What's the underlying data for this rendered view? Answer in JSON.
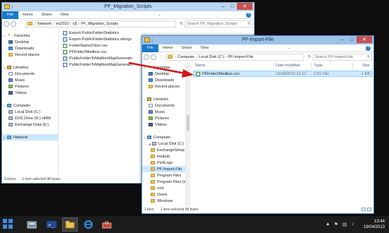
{
  "colors": {
    "accent": "#1979ca",
    "selection": "#cce8ff",
    "arrow": "#d11818"
  },
  "win1": {
    "title": "PF_Migration_Scripts",
    "tabs": [
      "File",
      "Home",
      "Share",
      "View"
    ],
    "address": [
      "Network",
      "ex2010",
      "c$",
      "PF_Migration_Scripts"
    ],
    "search_placeholder": "Search PF_Migration_Scripts",
    "nav": [
      {
        "label": "Favorites",
        "icon": "star-icon",
        "group": true
      },
      {
        "label": "Desktop",
        "icon": "desktop-icon"
      },
      {
        "label": "Downloads",
        "icon": "downloads-icon"
      },
      {
        "label": "Recent places",
        "icon": "recent-places-icon"
      },
      {
        "label": "",
        "icon": ""
      },
      {
        "label": "Libraries",
        "icon": "libraries-icon",
        "group": true
      },
      {
        "label": "Documents",
        "icon": "documents-icon"
      },
      {
        "label": "Music",
        "icon": "music-icon"
      },
      {
        "label": "Pictures",
        "icon": "pictures-icon"
      },
      {
        "label": "Videos",
        "icon": "videos-icon"
      },
      {
        "label": "",
        "icon": ""
      },
      {
        "label": "Computer",
        "icon": "computer-icon",
        "group": true
      },
      {
        "label": "Local Disk (C:)",
        "icon": "drive-icon"
      },
      {
        "label": "DVD Drive (D:) HRM",
        "icon": "dvd-icon"
      },
      {
        "label": "Exchange Data (E:)",
        "icon": "drive-icon"
      },
      {
        "label": "",
        "icon": ""
      },
      {
        "label": "Network",
        "icon": "network-icon",
        "group": true,
        "selected": true
      }
    ],
    "files": [
      {
        "name": "Export-PublicFolderStatistics",
        "type": "ps"
      },
      {
        "name": "Export-PublicFolderStatistics.strings",
        "type": "ps"
      },
      {
        "name": "FolderName2Size.csv",
        "type": "csv"
      },
      {
        "name": "PFfolder2Mailbox.csv",
        "type": "csv"
      },
      {
        "name": "PublicFolderToMailboxMapGenerator",
        "type": "ps"
      },
      {
        "name": "PublicFolderToMailboxMapGenerator.stri...",
        "type": "ps"
      }
    ],
    "status": [
      "6 items",
      "1 item selected  98 bytes"
    ]
  },
  "win2": {
    "title": "PF-Import-File",
    "tabs": [
      "File",
      "Home",
      "Share",
      "View"
    ],
    "address": [
      "Computer",
      "Local Disk (C:)",
      "PF-Import-File"
    ],
    "search_placeholder": "Search PF-Import-File",
    "nav": [
      {
        "label": "Favorites",
        "icon": "star-icon",
        "group": true
      },
      {
        "label": "Desktop",
        "icon": "desktop-icon"
      },
      {
        "label": "Downloads",
        "icon": "downloads-icon"
      },
      {
        "label": "Recent places",
        "icon": "recent-places-icon"
      },
      {
        "label": "",
        "icon": ""
      },
      {
        "label": "Libraries",
        "icon": "libraries-icon",
        "group": true
      },
      {
        "label": "Documents",
        "icon": "documents-icon"
      },
      {
        "label": "Music",
        "icon": "music-icon"
      },
      {
        "label": "Pictures",
        "icon": "pictures-icon"
      },
      {
        "label": "Videos",
        "icon": "videos-icon"
      },
      {
        "label": "",
        "icon": ""
      },
      {
        "label": "Computer",
        "icon": "computer-icon",
        "group": true
      },
      {
        "label": "Local Disk (C:)",
        "icon": "drive-icon",
        "sub": 1
      },
      {
        "label": "ExchangeSetup",
        "icon": "folder-icon",
        "sub": 2
      },
      {
        "label": "inetpub",
        "icon": "folder-icon",
        "sub": 2
      },
      {
        "label": "PerfLogs",
        "icon": "folder-icon",
        "sub": 2
      },
      {
        "label": "PF-Import-File",
        "icon": "folder-icon",
        "sub": 2,
        "selected": true
      },
      {
        "label": "Program Files",
        "icon": "folder-icon",
        "sub": 2
      },
      {
        "label": "Program Files (x",
        "icon": "folder-icon",
        "sub": 2
      },
      {
        "label": "root",
        "icon": "folder-icon",
        "sub": 2
      },
      {
        "label": "Users",
        "icon": "folder-icon",
        "sub": 2
      },
      {
        "label": "Windows",
        "icon": "folder-icon",
        "sub": 2
      }
    ],
    "columns": [
      "Name",
      "Date modified",
      "Type",
      "Size"
    ],
    "rows": [
      {
        "name": "PFfolder2Mailbox.csv",
        "date": "19/04/2013 12:21",
        "type": "CSV File",
        "size": "1 KB"
      }
    ],
    "status": [
      "1 item",
      "1 item selected  98 bytes"
    ]
  },
  "taskbar": {
    "apps": [
      "server-manager-icon",
      "powershell-icon",
      "file-explorer-icon",
      "internet-explorer-icon",
      "toolbox-icon"
    ],
    "time": "13:44",
    "date": "19/04/2013"
  }
}
